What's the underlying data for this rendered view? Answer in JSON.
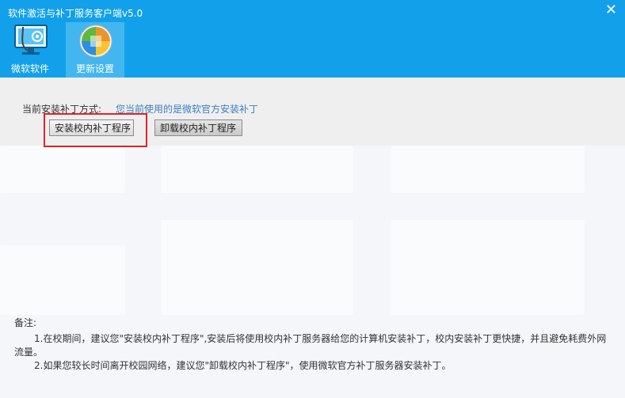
{
  "window": {
    "title": "软件激活与补丁服务客户端v5.0",
    "close_glyph": "✕"
  },
  "tabs": [
    {
      "label": "微软软件",
      "icon": "monitor-stethoscope-icon"
    },
    {
      "label": "更新设置",
      "icon": "windows-update-icon"
    }
  ],
  "active_tab": "更新设置",
  "main": {
    "mode_label": "当前安装补丁方式:",
    "mode_value": "您当前使用的是微软官方安装补丁",
    "install_button": "安装校内补丁程序",
    "uninstall_button": "卸载校内补丁程序"
  },
  "notes": {
    "title": "备注:",
    "line1a": "1.在校期间，建议您\"安装校内补丁程序\",安装后将使用校内补丁服务器给您的计算机安装补丁，校内安装补丁更快捷，并且避免耗费外网",
    "line1b": "流量。",
    "line2": "2.如果您较长时间离开校园网络，建议您\"卸载校内补丁程序\"，使用微软官方补丁服务器安装补丁。"
  },
  "colors": {
    "header": "#12a0ea",
    "active_tab": "#43b6ef",
    "highlight": "#e02424",
    "link_text": "#3b7fc4"
  }
}
